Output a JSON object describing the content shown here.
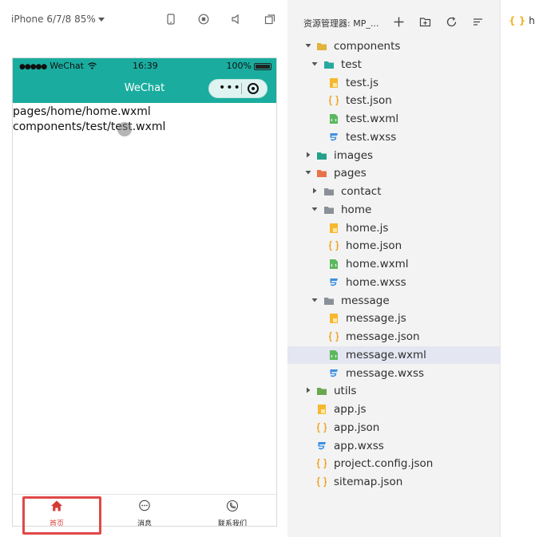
{
  "simulator": {
    "device_label": "iPhone 6/7/8 85%",
    "toolbar_icons": [
      "phone-icon",
      "record-icon",
      "volume-icon",
      "window-icon"
    ],
    "status_bar": {
      "carrier": "WeChat",
      "time": "16:39",
      "battery": "100%"
    },
    "nav_bar": {
      "title": "WeChat",
      "capsule_more": "•••"
    },
    "page_lines": [
      "pages/home/home.wxml",
      "components/test/test.wxml"
    ],
    "tabs": [
      {
        "label": "首页",
        "icon": "home-icon",
        "active": true
      },
      {
        "label": "消息",
        "icon": "message-icon",
        "active": false
      },
      {
        "label": "联系我们",
        "icon": "phone-call-icon",
        "active": false
      }
    ],
    "colors": {
      "nav_bg": "#1aad9f",
      "active_tab": "#d43c33",
      "highlight": "#e04848"
    }
  },
  "explorer": {
    "title": "资源管理器: MP_...",
    "header_icons": [
      "add-file-icon",
      "add-folder-icon",
      "refresh-icon",
      "collapse-icon"
    ],
    "tree": [
      {
        "name": "components",
        "type": "folder",
        "expanded": true,
        "depth": 0
      },
      {
        "name": "test",
        "type": "folder",
        "expanded": true,
        "depth": 1
      },
      {
        "name": "test.js",
        "type": "js",
        "depth": 2
      },
      {
        "name": "test.json",
        "type": "json",
        "depth": 2
      },
      {
        "name": "test.wxml",
        "type": "wxml",
        "depth": 2
      },
      {
        "name": "test.wxss",
        "type": "wxss",
        "depth": 2
      },
      {
        "name": "images",
        "type": "folder",
        "expanded": false,
        "depth": 0
      },
      {
        "name": "pages",
        "type": "folder",
        "expanded": true,
        "depth": 0
      },
      {
        "name": "contact",
        "type": "folder",
        "expanded": false,
        "depth": 1
      },
      {
        "name": "home",
        "type": "folder",
        "expanded": true,
        "depth": 1
      },
      {
        "name": "home.js",
        "type": "js",
        "depth": 2
      },
      {
        "name": "home.json",
        "type": "json",
        "depth": 2
      },
      {
        "name": "home.wxml",
        "type": "wxml",
        "depth": 2
      },
      {
        "name": "home.wxss",
        "type": "wxss",
        "depth": 2
      },
      {
        "name": "message",
        "type": "folder",
        "expanded": true,
        "depth": 1
      },
      {
        "name": "message.js",
        "type": "js",
        "depth": 2
      },
      {
        "name": "message.json",
        "type": "json",
        "depth": 2
      },
      {
        "name": "message.wxml",
        "type": "wxml",
        "depth": 2,
        "selected": true
      },
      {
        "name": "message.wxss",
        "type": "wxss",
        "depth": 2
      },
      {
        "name": "utils",
        "type": "folder",
        "expanded": false,
        "depth": 0
      },
      {
        "name": "app.js",
        "type": "js",
        "depth": 0,
        "rootfile": true
      },
      {
        "name": "app.json",
        "type": "json",
        "depth": 0,
        "rootfile": true
      },
      {
        "name": "app.wxss",
        "type": "wxss",
        "depth": 0,
        "rootfile": true
      },
      {
        "name": "project.config.json",
        "type": "json",
        "depth": 0,
        "rootfile": true
      },
      {
        "name": "sitemap.json",
        "type": "json",
        "depth": 0,
        "rootfile": true
      }
    ]
  },
  "editor": {
    "tab_icon": "{ }",
    "tab_label": "he"
  }
}
